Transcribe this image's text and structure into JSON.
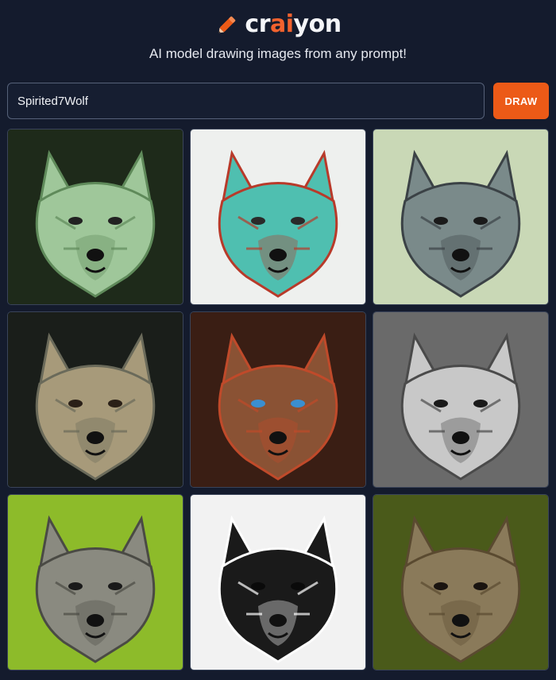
{
  "header": {
    "logo_text_part1": "cr",
    "logo_text_accent": "ai",
    "logo_text_part2": "yon",
    "tagline": "AI model drawing images from any prompt!"
  },
  "prompt": {
    "value": "Spirited7Wolf",
    "draw_label": "DRAW"
  },
  "gallery": {
    "images": [
      {
        "alt": "wolf image 1",
        "bg": "#1e2a1a",
        "fur": "#9fc79a",
        "accent": "#5f8a5a",
        "eye": "#222222"
      },
      {
        "alt": "wolf image 2",
        "bg": "#eef0ee",
        "fur": "#4fbfb0",
        "accent": "#b83a2a",
        "eye": "#2a2a2a"
      },
      {
        "alt": "wolf image 3",
        "bg": "#c9d8b6",
        "fur": "#7a8a8a",
        "accent": "#3b4246",
        "eye": "#1a1a1a"
      },
      {
        "alt": "wolf image 4",
        "bg": "#1a1e1a",
        "fur": "#a79a7a",
        "accent": "#6a6a5a",
        "eye": "#2a2018"
      },
      {
        "alt": "wolf image 5",
        "bg": "#3a1e14",
        "fur": "#8a5234",
        "accent": "#c04a2a",
        "eye": "#3a8fd0"
      },
      {
        "alt": "wolf image 6",
        "bg": "#6a6a6a",
        "fur": "#c8c8c8",
        "accent": "#4a4a4a",
        "eye": "#1a1a1a"
      },
      {
        "alt": "wolf image 7",
        "bg": "#8dbb2a",
        "fur": "#8a8a80",
        "accent": "#4a4a44",
        "eye": "#1a1a1a"
      },
      {
        "alt": "wolf image 8",
        "bg": "#f2f2f2",
        "fur": "#1a1a1a",
        "accent": "#ffffff",
        "eye": "#0a0a0a"
      },
      {
        "alt": "wolf image 9",
        "bg": "#4a5a1a",
        "fur": "#8a7a5a",
        "accent": "#5a4a30",
        "eye": "#1a1410"
      }
    ]
  },
  "colors": {
    "background": "#141b2d",
    "brand_orange": "#ec5a17",
    "input_border": "#566179"
  }
}
